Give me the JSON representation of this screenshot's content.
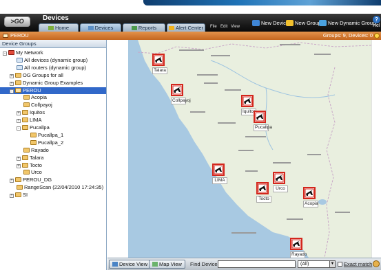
{
  "header": {
    "go_label": ">GO",
    "title": "Devices",
    "tabs": [
      {
        "label": "Home",
        "active": false
      },
      {
        "label": "Devices",
        "active": true
      },
      {
        "label": "Reports",
        "active": false
      },
      {
        "label": "Alert Center",
        "active": false
      }
    ],
    "menu": [
      "File",
      "Edit",
      "View"
    ],
    "actions": [
      {
        "label": "New Device",
        "icon": "new-device-icon",
        "color": "#3f86d6"
      },
      {
        "label": "New Group",
        "icon": "new-group-icon",
        "color": "#f2c12e"
      },
      {
        "label": "New Dynamic Group",
        "icon": "new-dynamic-group-icon",
        "color": "#4aa2e0"
      }
    ],
    "help_label": "Hel"
  },
  "breadcrumb": {
    "path": "PEROU",
    "counts": "Groups: 9, Devices: 0"
  },
  "left_panel": {
    "title": "Device Groups",
    "tree": [
      {
        "label": "My Network",
        "level": 0,
        "exp": "-",
        "icon": "red"
      },
      {
        "label": "All devices (dynamic group)",
        "level": 1,
        "exp": "",
        "icon": "dyn"
      },
      {
        "label": "All routers (dynamic group)",
        "level": 1,
        "exp": "",
        "icon": "dyn"
      },
      {
        "label": "OG Groups for all",
        "level": 1,
        "exp": "+",
        "icon": "folder"
      },
      {
        "label": "Dynamic Group Examples",
        "level": 1,
        "exp": "+",
        "icon": "folder"
      },
      {
        "label": "PEROU",
        "level": 1,
        "exp": "-",
        "icon": "folder",
        "selected": true
      },
      {
        "label": "Acopia",
        "level": 2,
        "exp": "",
        "icon": "folder"
      },
      {
        "label": "Collpayoj",
        "level": 2,
        "exp": "",
        "icon": "folder"
      },
      {
        "label": "Iquitos",
        "level": 2,
        "exp": "+",
        "icon": "folder"
      },
      {
        "label": "LIMA",
        "level": 2,
        "exp": "+",
        "icon": "folder"
      },
      {
        "label": "Pucallpa",
        "level": 2,
        "exp": "-",
        "icon": "folder"
      },
      {
        "label": "Pucallpa_1",
        "level": 3,
        "exp": "",
        "icon": "folder"
      },
      {
        "label": "Pucallpa_2",
        "level": 3,
        "exp": "",
        "icon": "folder"
      },
      {
        "label": "Rayado",
        "level": 2,
        "exp": "",
        "icon": "folder"
      },
      {
        "label": "Talara",
        "level": 2,
        "exp": "+",
        "icon": "folder"
      },
      {
        "label": "Tocto",
        "level": 2,
        "exp": "+",
        "icon": "folder"
      },
      {
        "label": "Urco",
        "level": 2,
        "exp": "",
        "icon": "folder"
      },
      {
        "label": "PEROU_DG",
        "level": 1,
        "exp": "+",
        "icon": "folder"
      },
      {
        "label": "RangeScan (22/04/2010 17:24:35)",
        "level": 1,
        "exp": "",
        "icon": "folder"
      },
      {
        "label": "SI",
        "level": 1,
        "exp": "+",
        "icon": "folder"
      }
    ]
  },
  "map": {
    "devices": [
      "Talara",
      "Collpayoj",
      "Iquitos",
      "Pucallpa",
      "LIMA",
      "Urco",
      "Tocto",
      "Acopia",
      "Rayado"
    ],
    "colors": {
      "sea": "#a8c9e2",
      "land": "#e9efdf",
      "device_red": "#d3261c"
    }
  },
  "bottom": {
    "device_view": "Device View",
    "map_view": "Map View",
    "find_label": "Find Device:",
    "find_value": "",
    "select_value": "(All)",
    "exact_label": "Exact match"
  }
}
